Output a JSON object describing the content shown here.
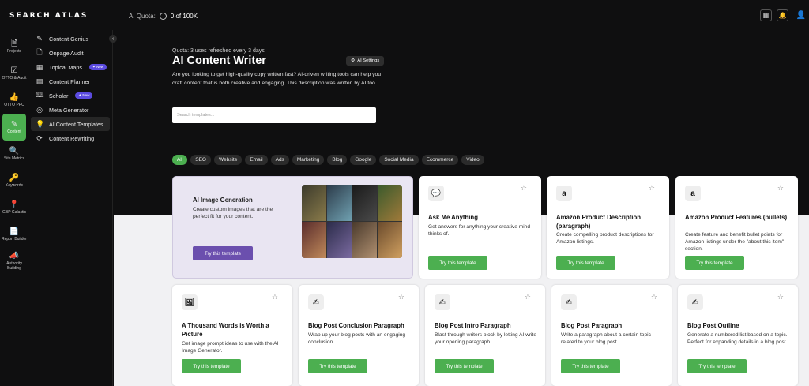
{
  "topbar": {
    "logo": "SEARCH ATLAS",
    "quota_label": "AI Quota:",
    "quota_value": "0 of 100K"
  },
  "rail": [
    {
      "label": "Projects",
      "icon": "file-icon"
    },
    {
      "label": "OTTO & Audit",
      "icon": "checklist-icon"
    },
    {
      "label": "OTTO PPC",
      "icon": "thumbs-up-icon"
    },
    {
      "label": "Content",
      "icon": "pencil-icon"
    },
    {
      "label": "Site Metrics",
      "icon": "magnifier-icon"
    },
    {
      "label": "Keywords",
      "icon": "key-icon"
    },
    {
      "label": "GBP Galactic",
      "icon": "pin-icon"
    },
    {
      "label": "Report Builder",
      "icon": "report-icon"
    },
    {
      "label": "Authority Building",
      "icon": "megaphone-icon"
    }
  ],
  "sidebar": {
    "items": [
      {
        "label": "Content Genius",
        "icon": "edit-icon"
      },
      {
        "label": "Onpage Audit",
        "icon": "doc-icon"
      },
      {
        "label": "Topical Maps",
        "icon": "grid-icon",
        "badge": "New"
      },
      {
        "label": "Content Planner",
        "icon": "calendar-icon"
      },
      {
        "label": "Scholar",
        "icon": "book-icon",
        "badge": "New"
      },
      {
        "label": "Meta Generator",
        "icon": "target-icon"
      },
      {
        "label": "AI Content Templates",
        "icon": "bulb-icon"
      },
      {
        "label": "Content Rewriting",
        "icon": "refresh-icon"
      }
    ]
  },
  "main": {
    "quota_line": "Quota: 3 uses refreshed every 3 days",
    "title": "AI Content Writer",
    "settings_label": "AI Settings",
    "description": "Are you looking to get high-quality copy written fast? AI-driven writing tools can help you craft content that is both creative and engaging. This description was written by AI too.",
    "search_placeholder": "Search templates...",
    "filters": [
      "All",
      "SEO",
      "Website",
      "Email",
      "Ads",
      "Marketing",
      "Blog",
      "Google",
      "Social Media",
      "Ecommerce",
      "Video"
    ]
  },
  "feature_card": {
    "title": "AI Image Generation",
    "description": "Create custom images that are the perfect fit for your content.",
    "button": "Try this template"
  },
  "cards": [
    {
      "icon": "💬",
      "title": "Ask Me Anything",
      "desc": "Get answers for anything your creative mind thinks of.",
      "button": "Try this template"
    },
    {
      "icon": "a",
      "title": "Amazon Product Description (paragraph)",
      "desc": "Create compelling product descriptions for Amazon listings.",
      "button": "Try this template"
    },
    {
      "icon": "a",
      "title": "Amazon Product Features (bullets)",
      "desc": "Create feature and benefit bullet points for Amazon listings under the \"about this item\" section.",
      "button": "Try this template"
    },
    {
      "icon": "🖼",
      "title": "A Thousand Words is Worth a Picture",
      "desc": "Get image prompt ideas to use with the AI Image Generator.",
      "button": "Try this template"
    },
    {
      "icon": "✍",
      "title": "Blog Post Conclusion Paragraph",
      "desc": "Wrap up your blog posts with an engaging conclusion.",
      "button": "Try this template"
    },
    {
      "icon": "✍",
      "title": "Blog Post Intro Paragraph",
      "desc": "Blast through writers block by letting AI write your opening paragraph",
      "button": "Try this template"
    },
    {
      "icon": "✍",
      "title": "Blog Post Paragraph",
      "desc": "Write a paragraph about a certain topic related to your blog post.",
      "button": "Try this template"
    },
    {
      "icon": "✍",
      "title": "Blog Post Outline",
      "desc": "Generate a numbered list based on a topic. Perfect for expanding details in a blog post.",
      "button": "Try this template"
    }
  ],
  "colors": {
    "accent": "#4caf50",
    "feature_button": "#6b4fae",
    "badge": "#5b4be0"
  }
}
